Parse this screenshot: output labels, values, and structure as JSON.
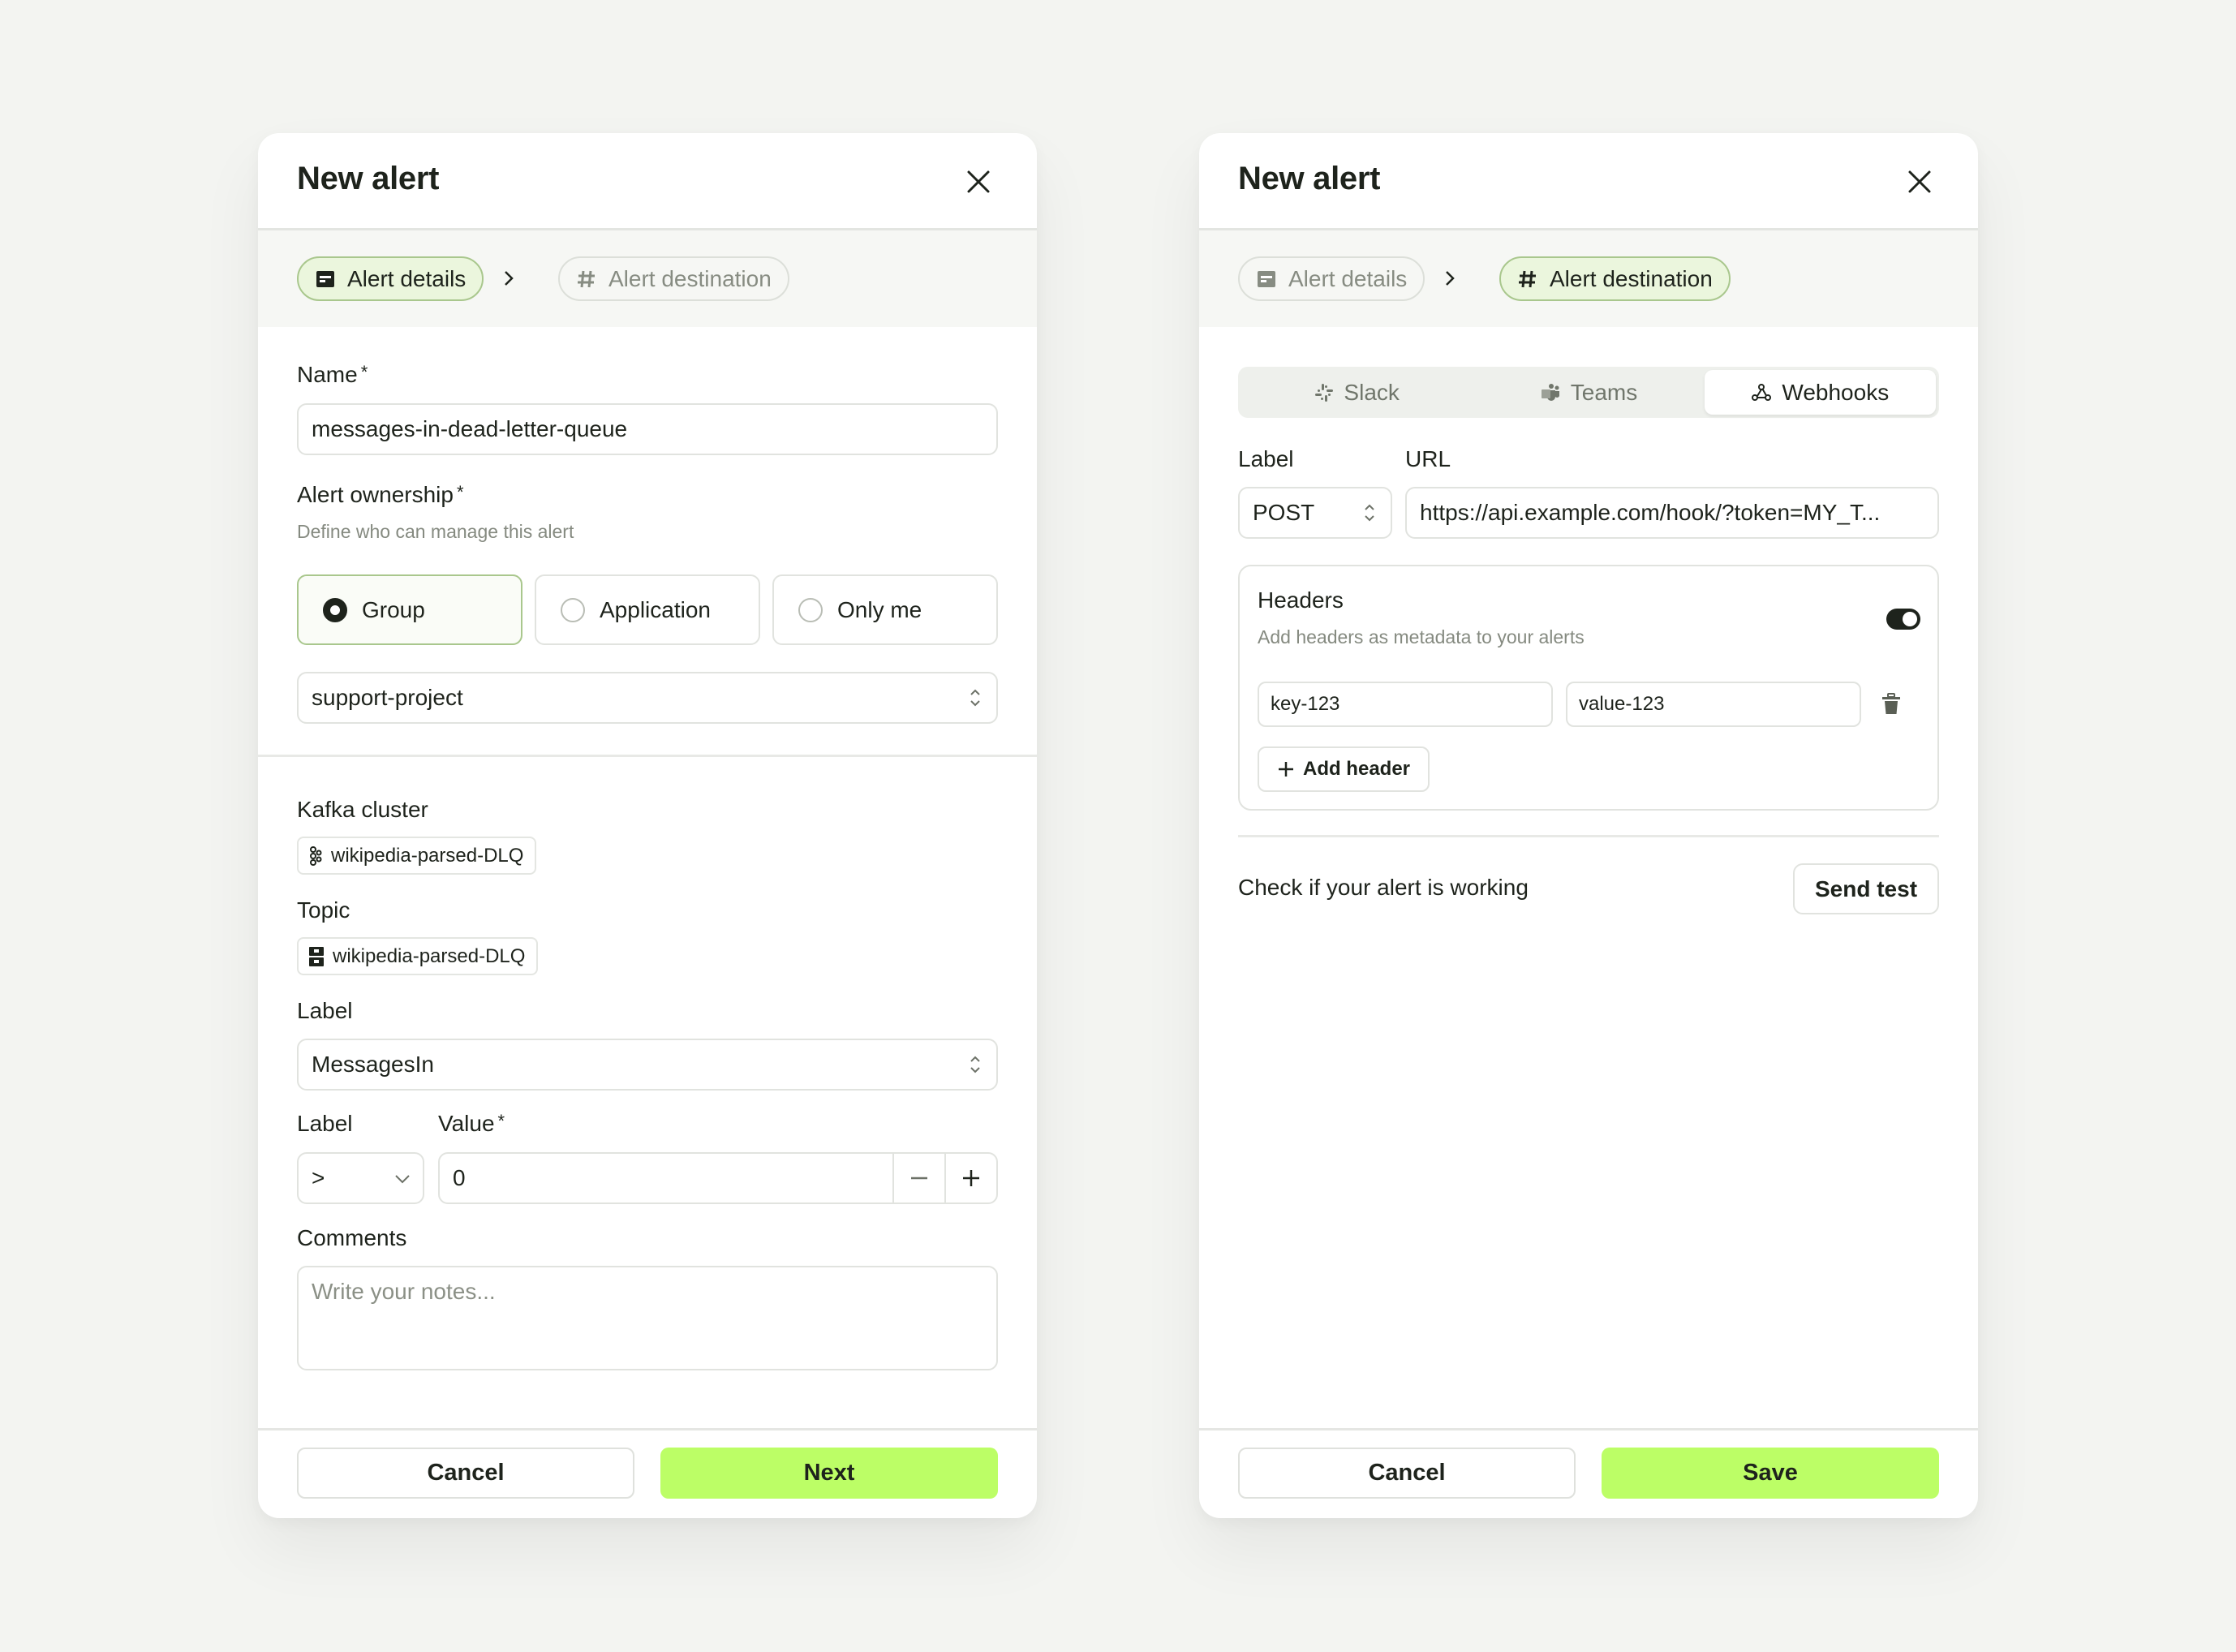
{
  "colors": {
    "accent": "#bcfe66",
    "active_pill_bg": "#ebf6dd",
    "active_pill_border": "#a9c78d",
    "text": "#1e231c",
    "muted": "#858a80",
    "page_bg": "#f3f4f1"
  },
  "left_dialog": {
    "title": "New alert",
    "close_icon": "close-icon",
    "steps": [
      {
        "label": "Alert details",
        "icon": "form-icon",
        "active": true
      },
      {
        "label": "Alert destination",
        "icon": "hash-icon",
        "active": false
      }
    ],
    "name": {
      "label": "Name",
      "required": "*",
      "value": "messages-in-dead-letter-queue"
    },
    "ownership": {
      "label": "Alert ownership",
      "required": "*",
      "description": "Define who can manage this alert",
      "options": [
        {
          "label": "Group",
          "selected": true
        },
        {
          "label": "Application",
          "selected": false
        },
        {
          "label": "Only me",
          "selected": false
        }
      ],
      "group_select_value": "support-project"
    },
    "kafka_cluster": {
      "label": "Kafka cluster",
      "value": "wikipedia-parsed-DLQ",
      "icon": "kafka-icon"
    },
    "topic": {
      "label": "Topic",
      "value": "wikipedia-parsed-DLQ",
      "icon": "topic-icon"
    },
    "metric_label": {
      "label": "Label",
      "value": "MessagesIn"
    },
    "condition": {
      "operator_label": "Label",
      "operator_value": ">",
      "value_label": "Value",
      "value_required": "*",
      "value": "0",
      "decrement": "−",
      "increment": "+"
    },
    "comments": {
      "label": "Comments",
      "placeholder": "Write your notes..."
    },
    "footer": {
      "cancel": "Cancel",
      "primary": "Next"
    }
  },
  "right_dialog": {
    "title": "New alert",
    "close_icon": "close-icon",
    "steps": [
      {
        "label": "Alert details",
        "icon": "form-icon",
        "active": false
      },
      {
        "label": "Alert destination",
        "icon": "hash-icon",
        "active": true
      }
    ],
    "tabs": [
      {
        "label": "Slack",
        "icon": "slack-icon",
        "active": false
      },
      {
        "label": "Teams",
        "icon": "teams-icon",
        "active": false
      },
      {
        "label": "Webhooks",
        "icon": "webhook-icon",
        "active": true
      }
    ],
    "method": {
      "label": "Label",
      "value": "POST"
    },
    "url": {
      "label": "URL",
      "value": "https://api.example.com/hook/?token=MY_T..."
    },
    "headers": {
      "title": "Headers",
      "description": "Add headers as metadata to your alerts",
      "enabled": true,
      "rows": [
        {
          "key": "key-123",
          "value": "value-123"
        }
      ],
      "add_label": "Add header"
    },
    "test": {
      "text": "Check if your alert is working",
      "button": "Send test"
    },
    "footer": {
      "cancel": "Cancel",
      "primary": "Save"
    }
  }
}
